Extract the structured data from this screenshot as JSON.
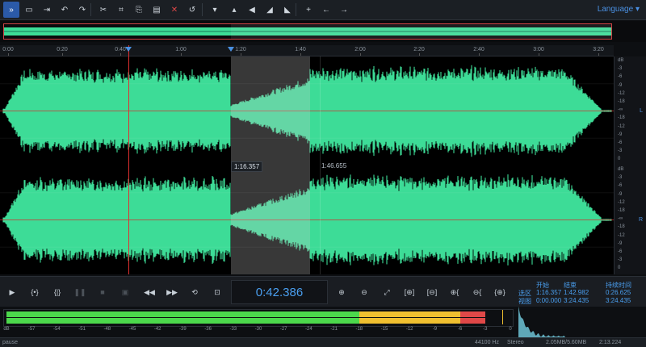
{
  "toolbar": {
    "buttons": [
      {
        "name": "collapse-panel-icon",
        "glyph": "»",
        "active": true
      },
      {
        "name": "open-folder-icon",
        "glyph": "▭"
      },
      {
        "name": "export-icon",
        "glyph": "⇥"
      },
      {
        "name": "undo-icon",
        "glyph": "↶"
      },
      {
        "name": "redo-icon",
        "glyph": "↷"
      },
      {
        "name": "cut-icon",
        "glyph": "✂"
      },
      {
        "name": "crop-icon",
        "glyph": "⌗"
      },
      {
        "name": "copy-icon",
        "glyph": "⎘"
      },
      {
        "name": "paste-icon",
        "glyph": "▤"
      },
      {
        "name": "delete-icon",
        "glyph": "✕"
      },
      {
        "name": "reset-icon",
        "glyph": "↺"
      },
      {
        "name": "dropdown-icon",
        "glyph": "▾"
      },
      {
        "name": "silence-icon",
        "glyph": "▴"
      },
      {
        "name": "volume-icon",
        "glyph": "◀"
      },
      {
        "name": "fade-in-icon",
        "glyph": "◢"
      },
      {
        "name": "fade-out-icon",
        "glyph": "◣"
      },
      {
        "name": "add-marker-icon",
        "glyph": "+"
      },
      {
        "name": "move-left-icon",
        "glyph": "←"
      },
      {
        "name": "move-right-icon",
        "glyph": "→"
      }
    ],
    "language_label": "Language"
  },
  "ruler": {
    "labels": [
      "0:00",
      "0:20",
      "0:40",
      "1:00",
      "1:20",
      "1:40",
      "2:00",
      "2:20",
      "2:40",
      "3:00",
      "3:20"
    ]
  },
  "waveform": {
    "cursor_time": "1:16.357",
    "hover_time": "1:46.655",
    "color": "#3ddc97"
  },
  "db_scale": {
    "labels": [
      "dB",
      "-3",
      "-6",
      "-9",
      "-12",
      "-18",
      "-∞",
      "-18",
      "-12",
      "-9",
      "-6",
      "-3",
      "0"
    ],
    "left_channel": "L",
    "right_channel": "R"
  },
  "transport": {
    "current_time": "0:42.386",
    "buttons": [
      {
        "name": "play-icon",
        "glyph": "▶",
        "dim": false
      },
      {
        "name": "select-all-icon",
        "glyph": "{•}",
        "dim": false
      },
      {
        "name": "select-range-icon",
        "glyph": "{|}",
        "dim": false
      },
      {
        "name": "pause-icon",
        "glyph": "❚❚",
        "dim": true
      },
      {
        "name": "stop-icon",
        "glyph": "■",
        "dim": true
      },
      {
        "name": "record-icon",
        "glyph": "▣",
        "dim": true
      },
      {
        "name": "rewind-icon",
        "glyph": "◀◀",
        "dim": false
      },
      {
        "name": "fast-forward-icon",
        "glyph": "▶▶",
        "dim": false
      },
      {
        "name": "loop-icon",
        "glyph": "⟲",
        "dim": false
      },
      {
        "name": "skip-selection-icon",
        "glyph": "⊡",
        "dim": false
      }
    ],
    "zoom_buttons": [
      {
        "name": "zoom-in-icon",
        "glyph": "⊕"
      },
      {
        "name": "zoom-out-icon",
        "glyph": "⊖"
      },
      {
        "name": "zoom-fit-icon",
        "glyph": "⤢"
      },
      {
        "name": "zoom-selection-in-icon",
        "glyph": "[⊕]"
      },
      {
        "name": "zoom-selection-out-icon",
        "glyph": "[⊖]"
      },
      {
        "name": "zoom-left-icon",
        "glyph": "⊕{"
      },
      {
        "name": "zoom-right-icon",
        "glyph": "⊖{"
      },
      {
        "name": "zoom-all-icon",
        "glyph": "{⊕}"
      }
    ]
  },
  "selection_info": {
    "header_start": "开始",
    "header_end": "结束",
    "header_duration": "持续时间",
    "row1_label": "选区",
    "row1_start": "1:16.357",
    "row1_end": "1:42.982",
    "row1_duration": "0:26.625",
    "row2_label": "视图",
    "row2_start": "0:00.000",
    "row2_end": "3:24.435",
    "row2_duration": "3:24.435"
  },
  "meter": {
    "labels": [
      "dB",
      "-57",
      "-54",
      "-51",
      "-48",
      "-45",
      "-42",
      "-39",
      "-36",
      "-33",
      "-30",
      "-27",
      "-24",
      "-21",
      "-18",
      "-15",
      "-12",
      "-9",
      "-6",
      "-3",
      "0"
    ],
    "level_db": -3,
    "peak_db": -1
  },
  "status": {
    "state": "pause",
    "sample_rate": "44100 Hz",
    "channels": "Stereo",
    "memory": "2.05MB/5.60MB",
    "length": "2:13.224"
  }
}
